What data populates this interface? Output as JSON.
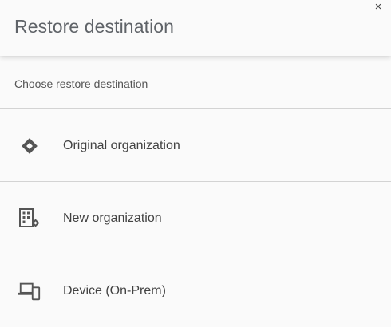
{
  "dialog": {
    "title": "Restore destination",
    "close_glyph": "×",
    "subtitle": "Choose restore destination",
    "options": [
      {
        "label": "Original organization",
        "icon": "diamond-icon"
      },
      {
        "label": "New organization",
        "icon": "building-icon"
      },
      {
        "label": "Device (On-Prem)",
        "icon": "devices-icon"
      }
    ]
  },
  "colors": {
    "background": "#fafafa",
    "divider": "#d3d3d3",
    "icon": "#555555",
    "text": "#424242"
  }
}
